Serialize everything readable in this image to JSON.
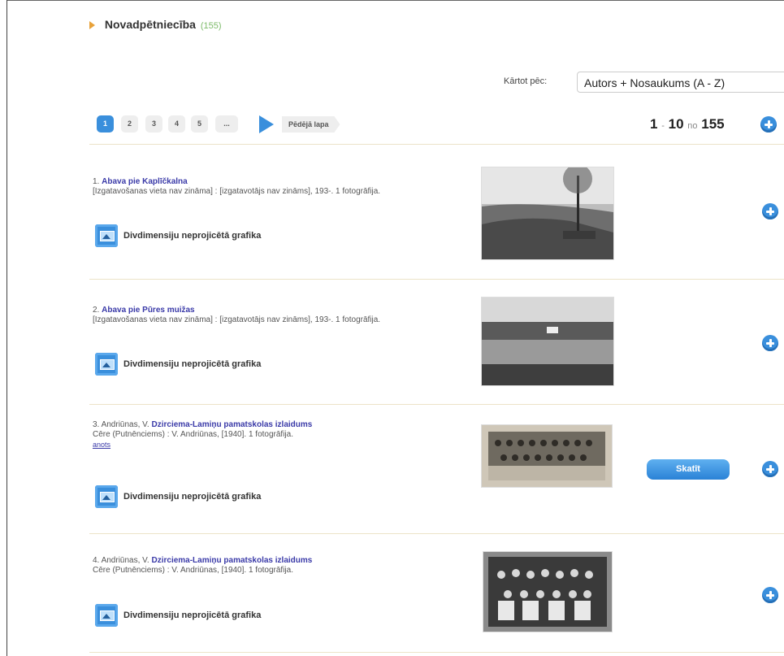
{
  "section": {
    "title": "Novadpētniecība",
    "count": "(155)"
  },
  "sort": {
    "label": "Kārtot pēc:",
    "value": "Autors + Nosaukums (A - Z)"
  },
  "pager": {
    "pages": [
      "1",
      "2",
      "3",
      "4",
      "5",
      "..."
    ],
    "last": "Pēdējā lapa"
  },
  "range": {
    "from": "1",
    "sep": "-",
    "to": "10",
    "of": "no",
    "total": "155"
  },
  "results": [
    {
      "num": "1.",
      "author": "",
      "title": "Abava pie Kaplīčkalna",
      "desc": "[Izgatavošanas vieta nav zināma] : [izgatavotājs nav zināms], 193-. 1 fotogrāfija.",
      "link": "",
      "type": "Divdimensiju neprojicētā grafika"
    },
    {
      "num": "2.",
      "author": "",
      "title": "Abava pie Pūres muižas",
      "desc": "[Izgatavošanas vieta nav zināma] : [izgatavotājs nav zināms], 193-. 1 fotogrāfija.",
      "link": "",
      "type": "Divdimensiju neprojicētā grafika"
    },
    {
      "num": "3.",
      "author": "Andriūnas, V.",
      "title": "Dzirciema-Lamiņu pamatskolas izlaidums",
      "desc": "Cēre (Putnēnciems) : V. Andriūnas, [1940]. 1 fotogrāfija.",
      "link": "anots",
      "type": "Divdimensiju neprojicētā grafika",
      "button": "Skatīt"
    },
    {
      "num": "4.",
      "author": "Andriūnas, V.",
      "title": "Dzirciema-Lamiņu pamatskolas izlaidums",
      "desc": "Cēre (Putnēnciems) : V. Andriūnas, [1940]. 1 fotogrāfija.",
      "link": "",
      "type": "Divdimensiju neprojicētā grafika"
    }
  ]
}
